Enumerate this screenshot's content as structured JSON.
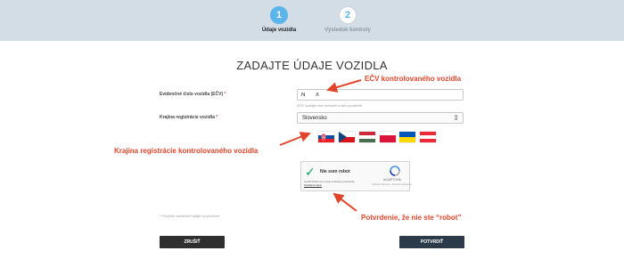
{
  "stepper": {
    "steps": [
      {
        "number": "1",
        "label": "Údaje vozidla",
        "state": "active"
      },
      {
        "number": "2",
        "label": "Výsledok kontroly",
        "state": "inactive"
      }
    ]
  },
  "form": {
    "title": "ZADAJTE ÚDAJE VOZIDLA",
    "ecv": {
      "label": "Evidenčné číslo vozidla (EČV)",
      "required_mark": "*",
      "value": "N       X",
      "hint": "EČV zadajte bez medzier a bez pomlčiek"
    },
    "country": {
      "label": "Krajina registrácie vozidla",
      "required_mark": "*",
      "selected": "Slovensko"
    },
    "flags": [
      {
        "name": "slovakia"
      },
      {
        "name": "czech-republic"
      },
      {
        "name": "hungary"
      },
      {
        "name": "poland"
      },
      {
        "name": "ukraine"
      },
      {
        "name": "austria"
      }
    ],
    "required_note": "* Povinne označené údaje sú povinné"
  },
  "captcha": {
    "label": "Nie som robot",
    "brand": "reCAPTCHA",
    "small_text": "reCAPTCHA mení svoje ochranné podmienky.",
    "small_link": "Podniknúť akciu",
    "links": "Ochrana súkromia - Zmluvné podmienky"
  },
  "buttons": {
    "cancel": "ZRUŠIŤ",
    "confirm": "POTVRDIŤ"
  },
  "annotations": {
    "ecv": "EČV kontrolovaného vozidla",
    "country": "Krajina registrácie kontrolovaného vozidla",
    "robot": "Potvrdenie, že nie ste “robot”"
  },
  "colors": {
    "accent": "#5bb4ea",
    "annotation": "#e0452b",
    "header_bg": "#d2dde6",
    "cancel_bg": "#2f2f2f",
    "confirm_bg": "#2c3b4a",
    "check": "#0b9d58"
  }
}
